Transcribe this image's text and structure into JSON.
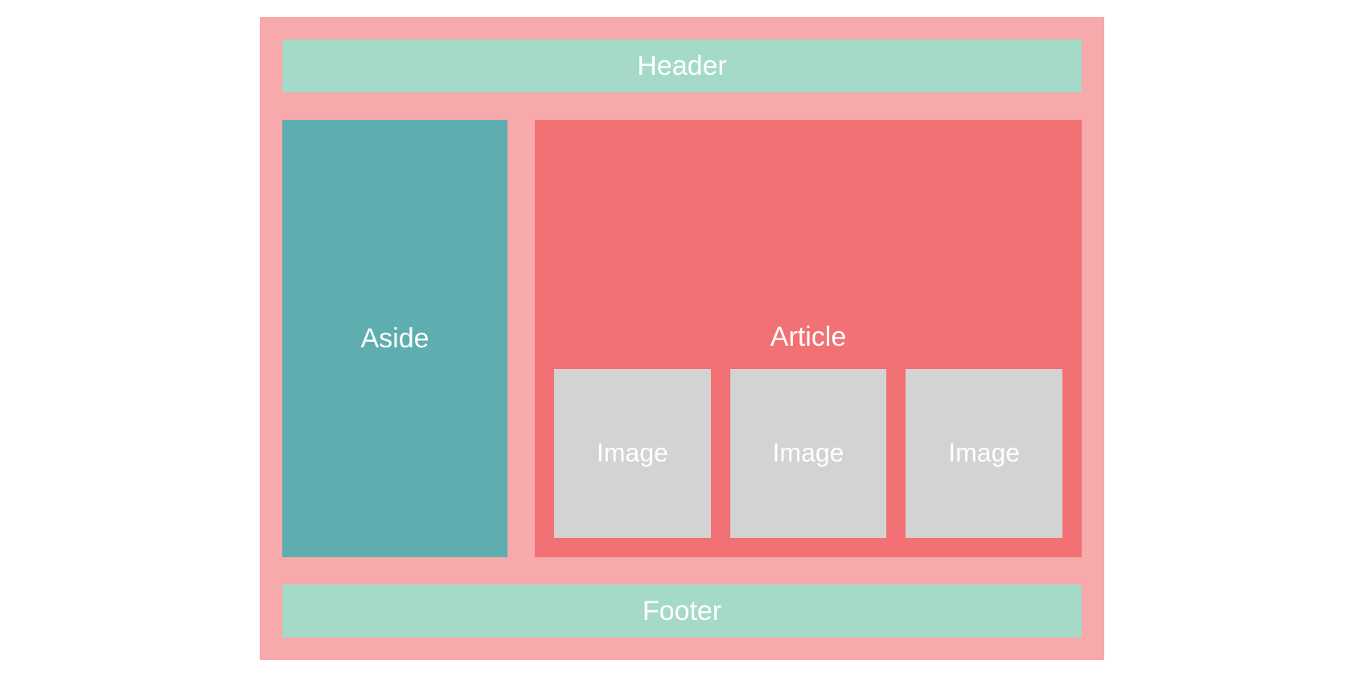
{
  "header": {
    "label": "Header"
  },
  "aside": {
    "label": "Aside"
  },
  "article": {
    "label": "Article",
    "images": [
      {
        "label": "Image"
      },
      {
        "label": "Image"
      },
      {
        "label": "Image"
      }
    ]
  },
  "footer": {
    "label": "Footer"
  },
  "colors": {
    "container_bg": "#f7a9ab",
    "header_bg": "#a6dac8",
    "aside_bg": "#5eaeaf",
    "article_bg": "#f17174",
    "image_bg": "#d3d3d3",
    "text": "#ffffff"
  }
}
